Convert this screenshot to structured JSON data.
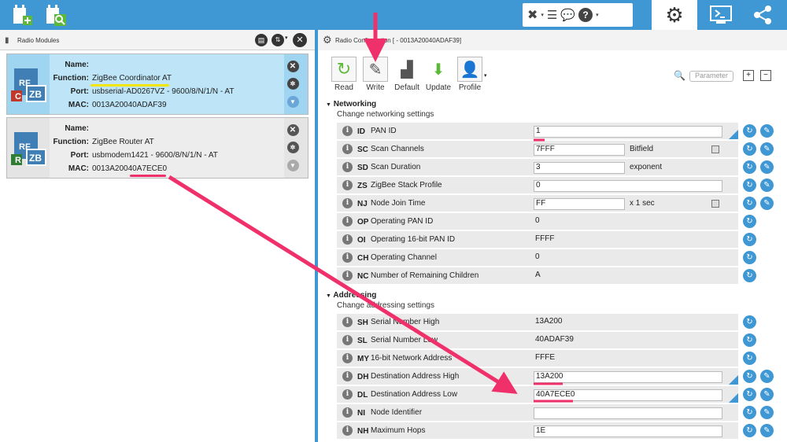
{
  "left_panel": {
    "title": "Radio Modules",
    "labels": {
      "name": "Name:",
      "function": "Function:",
      "port": "Port:",
      "mac": "MAC:"
    },
    "modules": [
      {
        "badge": "C",
        "function": "ZigBee Coordinator AT",
        "port": "usbserial-AD0267VZ - 9600/8/N/1/N - AT",
        "mac": "0013A20040ADAF39",
        "name": ""
      },
      {
        "badge": "R",
        "function": "ZigBee Router AT",
        "port": "usbmodem1421 - 9600/8/N/1/N - AT",
        "mac": "0013A20040A7ECE0",
        "name": ""
      }
    ]
  },
  "right_panel": {
    "title": "Radio Configuration [ - 0013A20040ADAF39]",
    "toolbar": [
      {
        "label": "Read"
      },
      {
        "label": "Write"
      },
      {
        "label": "Default"
      },
      {
        "label": "Update"
      },
      {
        "label": "Profile"
      }
    ],
    "search_placeholder": "Parameter",
    "networking": {
      "header": "Networking",
      "subtitle": "Change networking settings",
      "params": [
        {
          "code": "ID",
          "name": "PAN ID",
          "value": "1",
          "suffix": ""
        },
        {
          "code": "SC",
          "name": "Scan Channels",
          "value": "7FFF",
          "suffix": "Bitfield"
        },
        {
          "code": "SD",
          "name": "Scan Duration",
          "value": "3",
          "suffix": "exponent"
        },
        {
          "code": "ZS",
          "name": "ZigBee Stack Profile",
          "value": "0",
          "suffix": ""
        },
        {
          "code": "NJ",
          "name": "Node Join Time",
          "value": "FF",
          "suffix": "x 1 sec"
        },
        {
          "code": "OP",
          "name": "Operating PAN ID",
          "value": "0",
          "suffix": ""
        },
        {
          "code": "OI",
          "name": "Operating 16-bit PAN ID",
          "value": "FFFF",
          "suffix": ""
        },
        {
          "code": "CH",
          "name": "Operating Channel",
          "value": "0",
          "suffix": ""
        },
        {
          "code": "NC",
          "name": "Number of Remaining Children",
          "value": "A",
          "suffix": ""
        }
      ]
    },
    "addressing": {
      "header": "Addressing",
      "subtitle": "Change addressing settings",
      "params": [
        {
          "code": "SH",
          "name": "Serial Number High",
          "value": "13A200"
        },
        {
          "code": "SL",
          "name": "Serial Number Low",
          "value": "40ADAF39"
        },
        {
          "code": "MY",
          "name": "16-bit Network Address",
          "value": "FFFE"
        },
        {
          "code": "DH",
          "name": "Destination Address High",
          "value": "13A200"
        },
        {
          "code": "DL",
          "name": "Destination Address Low",
          "value": "40A7ECE0"
        },
        {
          "code": "NI",
          "name": "Node Identifier",
          "value": ""
        },
        {
          "code": "NH",
          "name": "Maximum Hops",
          "value": "1E"
        }
      ]
    }
  },
  "colors": {
    "accent": "#3f97d3",
    "annotation": "#f0306a",
    "highlight": "#f2e600"
  }
}
